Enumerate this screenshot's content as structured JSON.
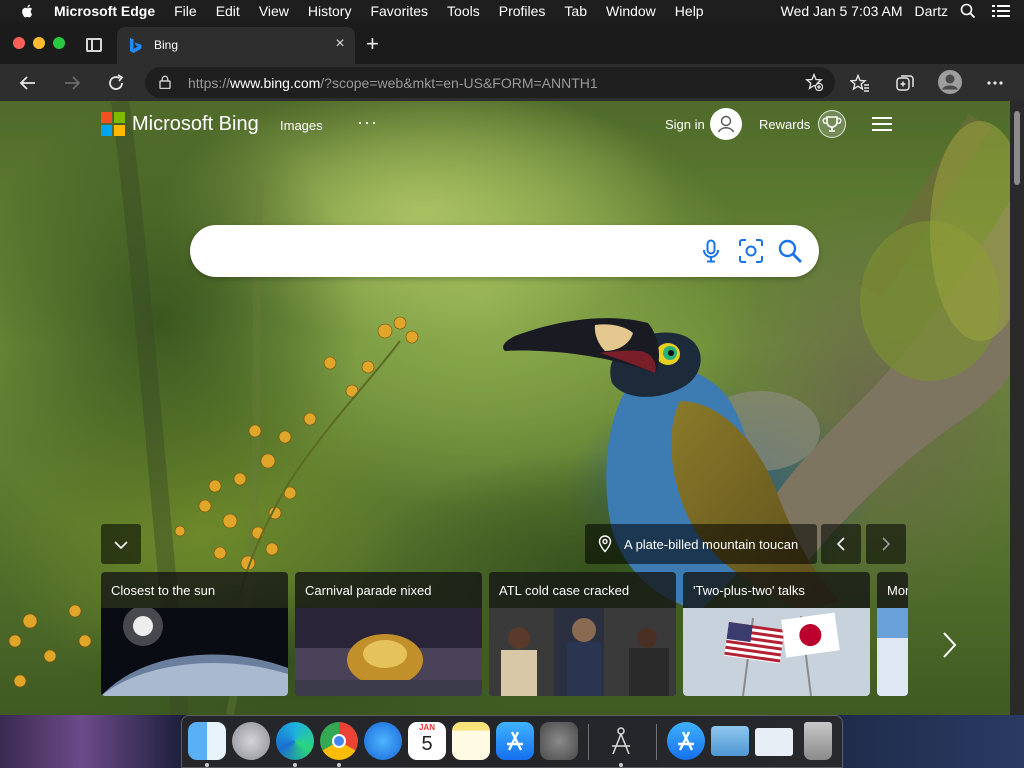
{
  "menubar": {
    "app_name": "Microsoft Edge",
    "menus": [
      "File",
      "Edit",
      "View",
      "History",
      "Favorites",
      "Tools",
      "Profiles",
      "Tab",
      "Window",
      "Help"
    ],
    "datetime": "Wed Jan 5  7:03 AM",
    "user": "Dartz"
  },
  "tab": {
    "title": "Bing"
  },
  "address_bar": {
    "url_prefix": "https://",
    "url_host": "www.bing.com",
    "url_rest": "/?scope=web&mkt=en-US&FORM=ANNTH1"
  },
  "bing": {
    "brand": "Microsoft Bing",
    "nav_images": "Images",
    "nav_more": "···",
    "sign_in": "Sign in",
    "rewards": "Rewards",
    "search_value": "",
    "image_caption": "A plate-billed mountain toucan"
  },
  "news": [
    {
      "title": "Closest to the sun"
    },
    {
      "title": "Carnival parade nixed"
    },
    {
      "title": "ATL cold case cracked"
    },
    {
      "title": "'Two-plus-two' talks"
    },
    {
      "title": "Mor"
    }
  ],
  "dock": {
    "items": [
      "Finder",
      "Launchpad",
      "Microsoft Edge",
      "Google Chrome",
      "Safari",
      "Calendar",
      "Notes",
      "App Store",
      "System Preferences",
      "Screenshot",
      "Applications",
      "Downloads",
      "Documents",
      "Trash"
    ],
    "calendar_month": "JAN",
    "calendar_day": "5"
  },
  "colors": {
    "ms_red": "#f25022",
    "ms_green": "#7fba00",
    "ms_blue": "#00a4ef",
    "ms_yellow": "#ffb900",
    "bing_blue": "#1a73e8",
    "edge_toolbar": "#2e2e2e"
  }
}
